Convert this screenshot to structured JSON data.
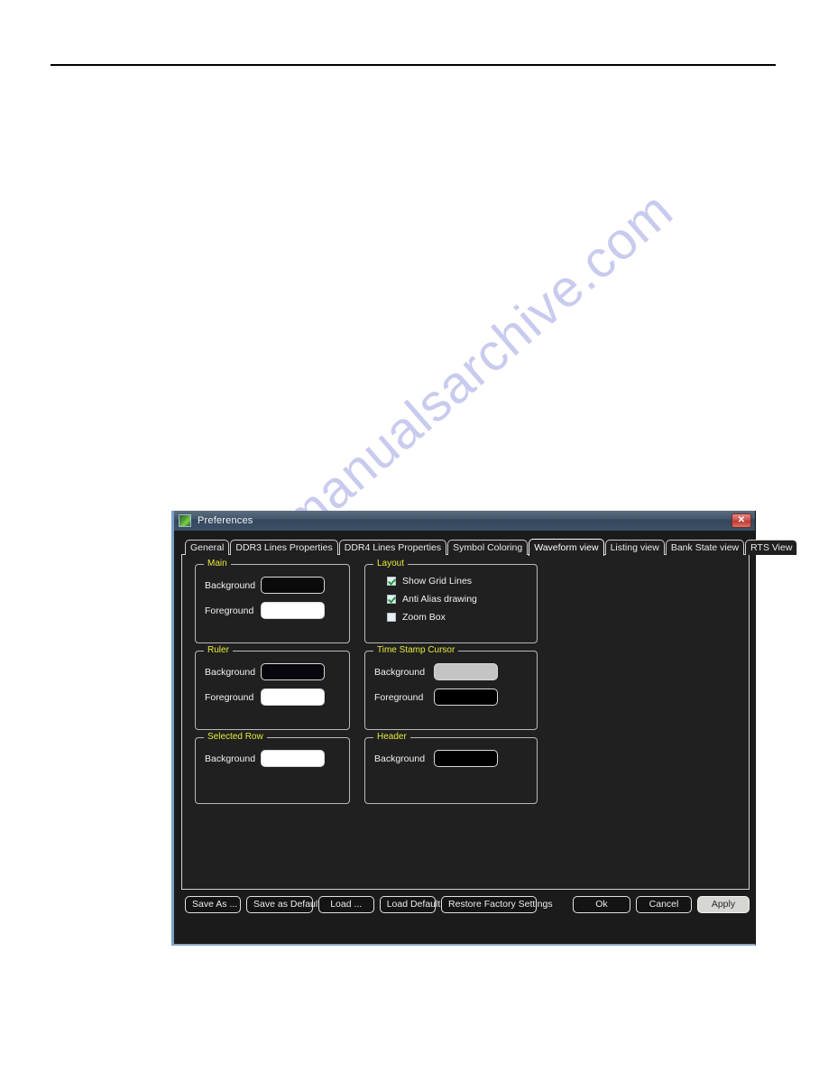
{
  "page": {
    "watermark_text": "manualsarchive.com"
  },
  "dialog": {
    "title": "Preferences",
    "app_icon": "app-icon",
    "close_label": "✕",
    "tabs": [
      {
        "label": "General",
        "active": false
      },
      {
        "label": "DDR3 Lines Properties",
        "active": false
      },
      {
        "label": "DDR4 Lines Properties",
        "active": false
      },
      {
        "label": "Symbol Coloring",
        "active": false
      },
      {
        "label": "Waveform view",
        "active": true
      },
      {
        "label": "Listing view",
        "active": false
      },
      {
        "label": "Bank State view",
        "active": false
      },
      {
        "label": "RTS View",
        "active": false
      }
    ],
    "groups": {
      "main": {
        "label": "Main",
        "background_label": "Background",
        "background_color": "#0a0a0a",
        "foreground_label": "Foreground",
        "foreground_color": "#ffffff"
      },
      "layout": {
        "label": "Layout",
        "options": [
          {
            "label": "Show Grid Lines",
            "checked": true
          },
          {
            "label": "Anti Alias drawing",
            "checked": true
          },
          {
            "label": "Zoom Box",
            "checked": false
          }
        ]
      },
      "ruler": {
        "label": "Ruler",
        "background_label": "Background",
        "background_color": "#06060c",
        "foreground_label": "Foreground",
        "foreground_color": "#ffffff"
      },
      "time_stamp_cursor": {
        "label": "Time Stamp Cursor",
        "background_label": "Background",
        "background_color": "#c4c4c4",
        "foreground_label": "Foreground",
        "foreground_color": "#000000"
      },
      "selected_row": {
        "label": "Selected Row",
        "background_label": "Background",
        "background_color": "#ffffff"
      },
      "header": {
        "label": "Header",
        "background_label": "Background",
        "background_color": "#000000"
      }
    },
    "footer": {
      "save_as": "Save As ...",
      "save_as_default": "Save as Default",
      "load": "Load ...",
      "load_default": "Load Default",
      "restore_factory_settings": "Restore Factory Settings",
      "ok": "Ok",
      "cancel": "Cancel",
      "apply": "Apply"
    }
  }
}
